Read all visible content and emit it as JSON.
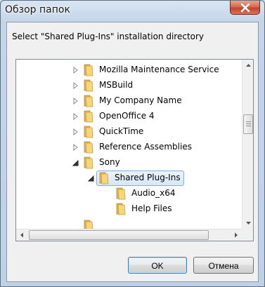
{
  "window": {
    "title": "Обзор папок"
  },
  "prompt": "Select \"Shared Plug-Ins\" installation directory",
  "tree": {
    "items": [
      {
        "label": "Mozilla Maintenance Service",
        "expander": "collapsed"
      },
      {
        "label": "MSBuild",
        "expander": "collapsed"
      },
      {
        "label": "My Company Name",
        "expander": "collapsed"
      },
      {
        "label": "OpenOffice 4",
        "expander": "collapsed"
      },
      {
        "label": "QuickTime",
        "expander": "collapsed"
      },
      {
        "label": "Reference Assemblies",
        "expander": "collapsed"
      },
      {
        "label": "Sony",
        "expander": "expanded"
      },
      {
        "label": "Shared Plug-Ins",
        "expander": "expanded",
        "selected": true
      },
      {
        "label": "Audio_x64",
        "expander": "none"
      },
      {
        "label": "Help Files",
        "expander": "none"
      }
    ]
  },
  "buttons": {
    "ok": "OK",
    "cancel": "Отмена"
  },
  "colors": {
    "selection_border": "#84acdd",
    "folder_yellow": "#f1cf6a",
    "close_red": "#c6432b"
  },
  "icons": {
    "close": "close-icon",
    "folder": "folder-icon",
    "collapsed": "expander-collapsed-icon",
    "expanded": "expander-expanded-icon"
  }
}
